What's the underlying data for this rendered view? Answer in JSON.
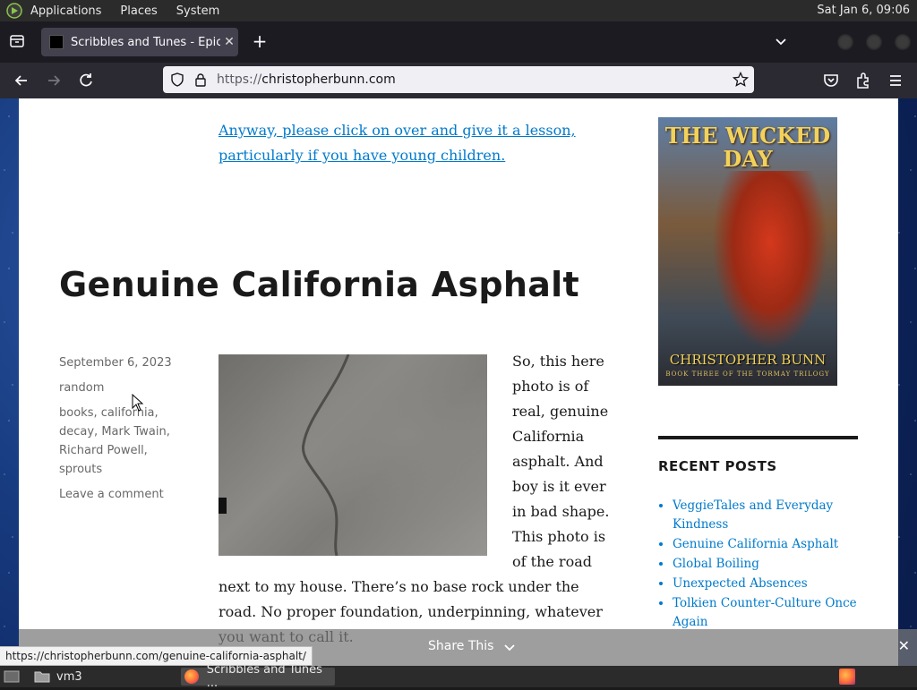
{
  "system_panel": {
    "menus": [
      "Applications",
      "Places",
      "System"
    ],
    "clock": "Sat Jan  6, 09:06"
  },
  "browser": {
    "tab_title": "Scribbles and Tunes - Epic fa",
    "url_scheme": "https://",
    "url_host": "christopherbunn.com"
  },
  "page": {
    "intro_link": "Anyway, please click on over and give it a lesson, particularly if you have young children.",
    "post_title": "Genuine California Asphalt",
    "meta": {
      "date": "September 6, 2023",
      "category": "random",
      "tags": "books, california, decay, Mark Twain, Richard Powell, sprouts",
      "comments": "Leave a comment"
    },
    "post_text": "So, this here photo is of real, genuine California asphalt. And boy is it ever in bad shape. This photo is of the road next to my house. There’s no base rock under the road. No proper foundation, underpinning, whatever you want to call it.",
    "sidebar": {
      "book_cover_title": "THE WICKED DAY",
      "book_cover_author": "CHRISTOPHER BUNN",
      "book_cover_subtitle": "BOOK THREE OF THE TORMAY TRILOGY",
      "recent_posts_heading": "RECENT POSTS",
      "recent_posts": [
        "VeggieTales and Everyday Kindness",
        "Genuine California Asphalt",
        "Global Boiling",
        "Unexpected Absences",
        "Tolkien Counter-Culture Once Again"
      ]
    },
    "share_bar": {
      "label": "Share This"
    }
  },
  "status_link": "https://christopherbunn.com/genuine-california-asphalt/",
  "taskbar": {
    "items": [
      "vm3",
      "Scribbles and Tunes ..."
    ]
  },
  "colors": {
    "link": "#007acc",
    "page_bg": "#ffffff",
    "chrome_dark": "#1c1b22"
  }
}
